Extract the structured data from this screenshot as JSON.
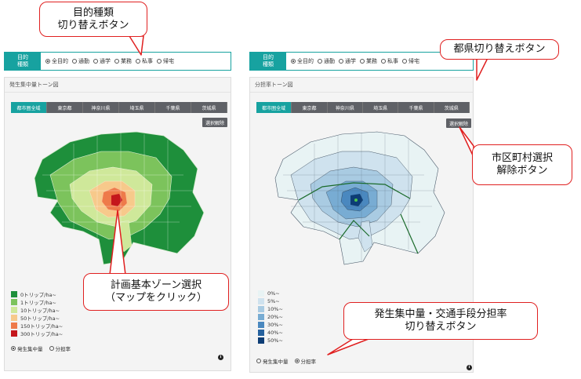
{
  "purpose_bar": {
    "label": "目的\n種類",
    "options": [
      "全目的",
      "通勤",
      "通学",
      "業務",
      "私事",
      "帰宅"
    ],
    "selected_index": 0
  },
  "left_panel": {
    "title": "発生集中量トーン図",
    "tabs": [
      "都市圏全域",
      "東京都",
      "神奈川県",
      "埼玉県",
      "千葉県",
      "茨城県"
    ],
    "active_tab": 0,
    "clear_button": "選択解除",
    "legend": [
      {
        "label": "0トリップ/ha~",
        "color": "#1e8f3b"
      },
      {
        "label": "1トリップ/ha~",
        "color": "#7cc35c"
      },
      {
        "label": "10トリップ/ha~",
        "color": "#cfe89a"
      },
      {
        "label": "50トリップ/ha~",
        "color": "#f7c98b"
      },
      {
        "label": "150トリップ/ha~",
        "color": "#ee7a4a"
      },
      {
        "label": "300トリップ/ha~",
        "color": "#c4161c"
      }
    ],
    "toggle": {
      "options": [
        "発生集中量",
        "分担率"
      ],
      "selected_index": 0
    }
  },
  "right_panel": {
    "title": "分担率トーン図",
    "tabs": [
      "都市圏全域",
      "東京都",
      "神奈川県",
      "埼玉県",
      "千葉県",
      "茨城県"
    ],
    "active_tab": 0,
    "clear_button": "選択解除",
    "legend": [
      {
        "label": "0%~",
        "color": "#e8f3f4"
      },
      {
        "label": "5%~",
        "color": "#cfe2ee"
      },
      {
        "label": "10%~",
        "color": "#a9cbe2"
      },
      {
        "label": "20%~",
        "color": "#78acd3"
      },
      {
        "label": "30%~",
        "color": "#4a88bf"
      },
      {
        "label": "40%~",
        "color": "#25619e"
      },
      {
        "label": "50%~",
        "color": "#0d3d75"
      }
    ],
    "toggle": {
      "options": [
        "発生集中量",
        "分担率"
      ],
      "selected_index": 1
    }
  },
  "callouts": {
    "purpose": [
      "目的種類",
      "切り替えボタン"
    ],
    "prefecture": [
      "都県切り替えボタン"
    ],
    "municipality": [
      "市区町村選択",
      "解除ボタン"
    ],
    "zone": [
      "計画基本ゾーン選択",
      "（マップをクリック）"
    ],
    "mode": [
      "発生集中量・交通手段分担率",
      "切り替えボタン"
    ]
  },
  "info_icon": "i",
  "colors": {
    "accent": "#17a2a0",
    "tab": "#5f6166",
    "callout_border": "#e02020"
  }
}
